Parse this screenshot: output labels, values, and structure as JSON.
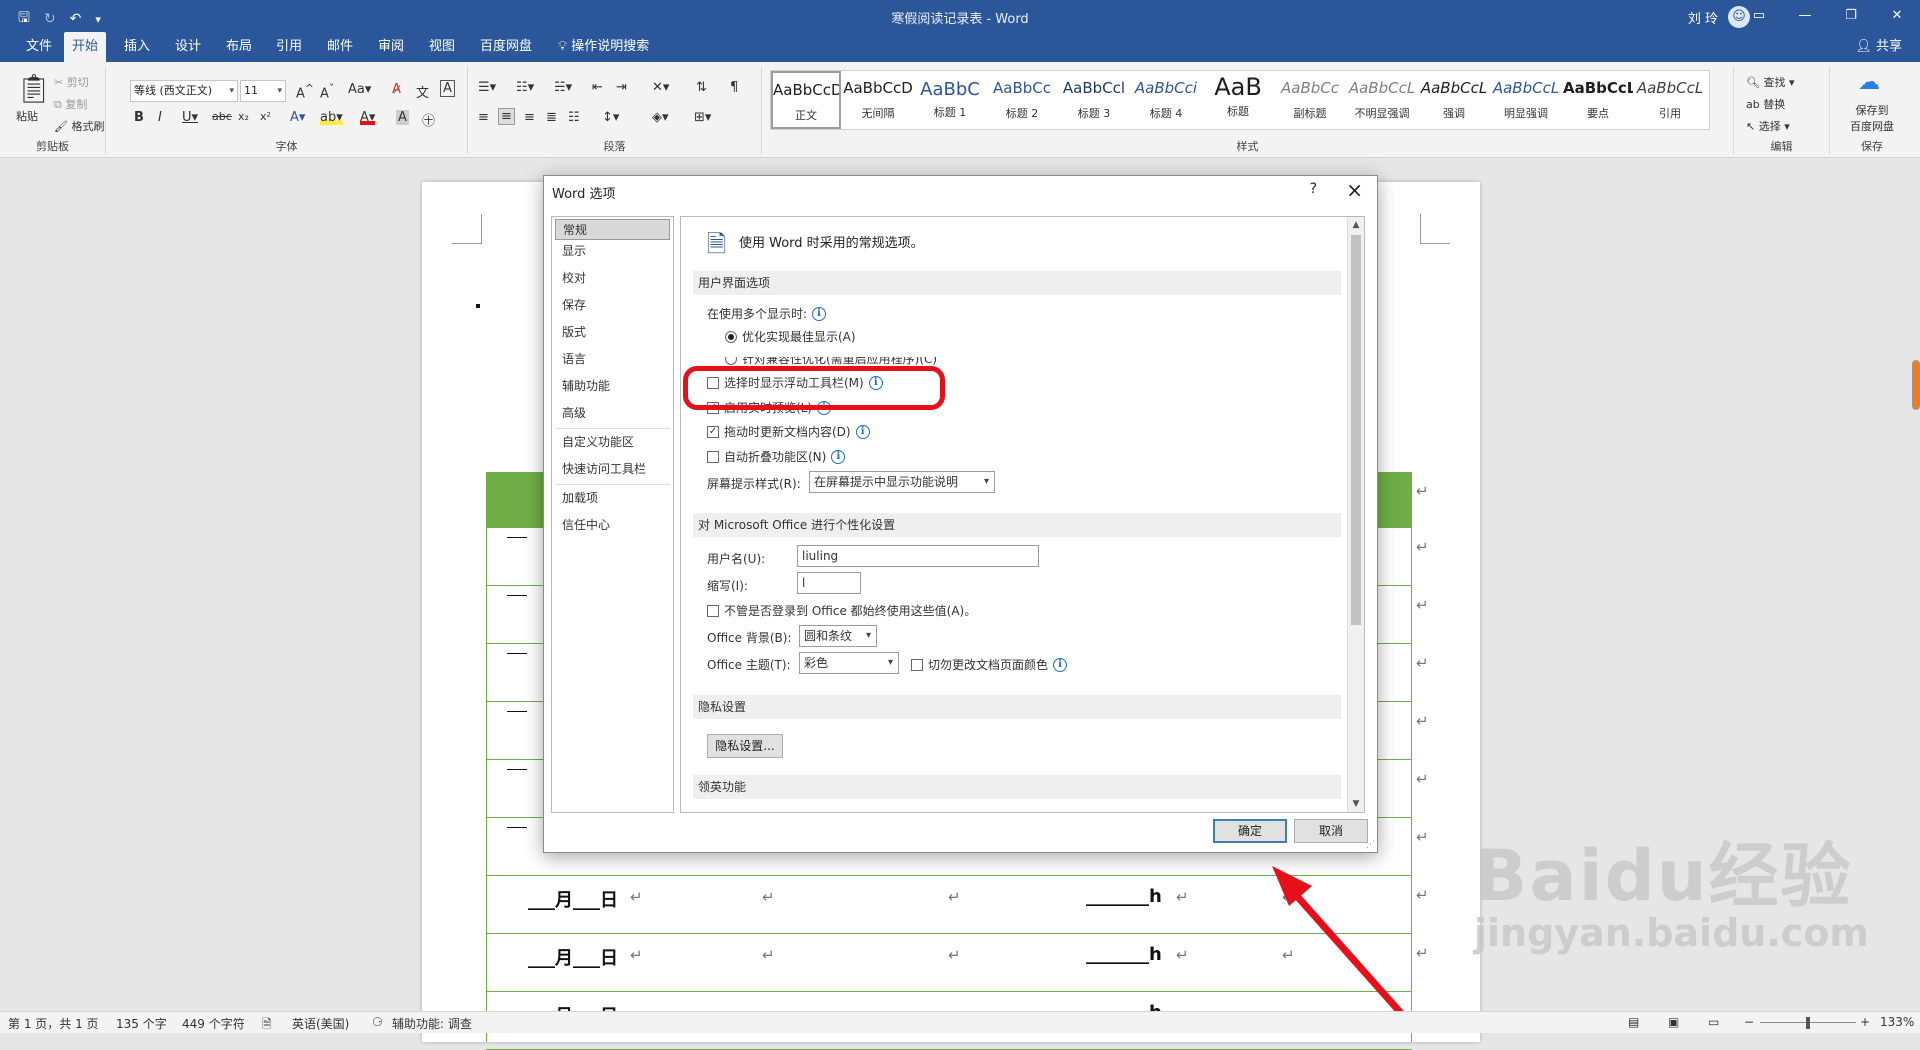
{
  "window": {
    "doc_title": "寒假阅读记录表 - Word",
    "user_name": "刘 玲"
  },
  "tabs": [
    "文件",
    "开始",
    "插入",
    "设计",
    "布局",
    "引用",
    "邮件",
    "审阅",
    "视图",
    "百度网盘"
  ],
  "search_label": "操作说明搜索",
  "share_label": "共享",
  "ribbon": {
    "clipboard": {
      "paste": "粘贴",
      "cut": "剪切",
      "copy": "复制",
      "format_painter": "格式刷",
      "label": "剪贴板"
    },
    "font": {
      "name": "等线 (西文正文)",
      "size": "11",
      "label": "字体"
    },
    "paragraph_label": "段落",
    "styles_label": "样式",
    "styles": [
      {
        "sample": "AaBbCcD",
        "name": "正文"
      },
      {
        "sample": "AaBbCcD",
        "name": "无间隔"
      },
      {
        "sample": "AaBbC",
        "name": "标题 1"
      },
      {
        "sample": "AaBbCc",
        "name": "标题 2"
      },
      {
        "sample": "AaBbCcl",
        "name": "标题 3"
      },
      {
        "sample": "AaBbCci",
        "name": "标题 4"
      },
      {
        "sample": "AaB",
        "name": "标题"
      },
      {
        "sample": "AaBbCc",
        "name": "副标题"
      },
      {
        "sample": "AaBbCcL",
        "name": "不明显强调"
      },
      {
        "sample": "AaBbCcL",
        "name": "强调"
      },
      {
        "sample": "AaBbCcL",
        "name": "明显强调"
      },
      {
        "sample": "AaBbCcL",
        "name": "要点"
      },
      {
        "sample": "AaBbCcL",
        "name": "引用"
      }
    ],
    "editing": {
      "find": "查找",
      "replace": "替换",
      "select": "选择",
      "label": "编辑"
    },
    "save": {
      "line1": "保存到",
      "line2": "百度网盘",
      "label": "保存"
    }
  },
  "document": {
    "rows": [
      {
        "date": "___月___日",
        "hours": "_______h"
      },
      {
        "date": "___月___日",
        "hours": "_______h"
      },
      {
        "date": "___月___日",
        "hours": "_______h"
      }
    ]
  },
  "dialog": {
    "title": "Word 选项",
    "help": "?",
    "nav": [
      "常规",
      "显示",
      "校对",
      "保存",
      "版式",
      "语言",
      "辅助功能",
      "高级",
      "自定义功能区",
      "快速访问工具栏",
      "加载项",
      "信任中心"
    ],
    "header_text": "使用 Word 时采用的常规选项。",
    "sections": {
      "ui": "用户界面选项",
      "personalize": "对 Microsoft Office 进行个性化设置",
      "privacy": "隐私设置",
      "linkedin": "领英功能"
    },
    "multi_display_label": "在使用多个显示时:",
    "radio_optimize": "优化实现最佳显示(A)",
    "radio_compat": "针对兼容性优化(需重启应用程序)(C)",
    "opt_mini_toolbar": "选择时显示浮动工具栏(M)",
    "opt_live_preview": "启用实时预览(L)",
    "opt_drag_update": "拖动时更新文档内容(D)",
    "opt_collapse_ribbon": "自动折叠功能区(N)",
    "screentip_label": "屏幕提示样式(R):",
    "screentip_value": "在屏幕提示中显示功能说明",
    "username_label": "用户名(U):",
    "username_value": "liuling",
    "initials_label": "缩写(I):",
    "initials_value": "l",
    "always_use": "不管是否登录到 Office 都始终使用这些值(A)。",
    "bg_label": "Office 背景(B):",
    "bg_value": "圆和条纹",
    "theme_label": "Office 主题(T):",
    "theme_value": "彩色",
    "never_change": "切勿更改文档页面颜色",
    "privacy_button": "隐私设置...",
    "ok": "确定",
    "cancel": "取消"
  },
  "status": {
    "page": "第 1 页，共 1 页",
    "words": "135 个字",
    "chars": "449 个字符",
    "lang": "英语(美国)",
    "access": "辅助功能: 调查",
    "zoom": "133%"
  },
  "watermark": {
    "main": "Baidu经验",
    "url": "jingyan.baidu.com"
  },
  "colors": {
    "word_blue": "#2b579a",
    "table_green": "#70ad47",
    "highlight_red": "#e5101a"
  }
}
